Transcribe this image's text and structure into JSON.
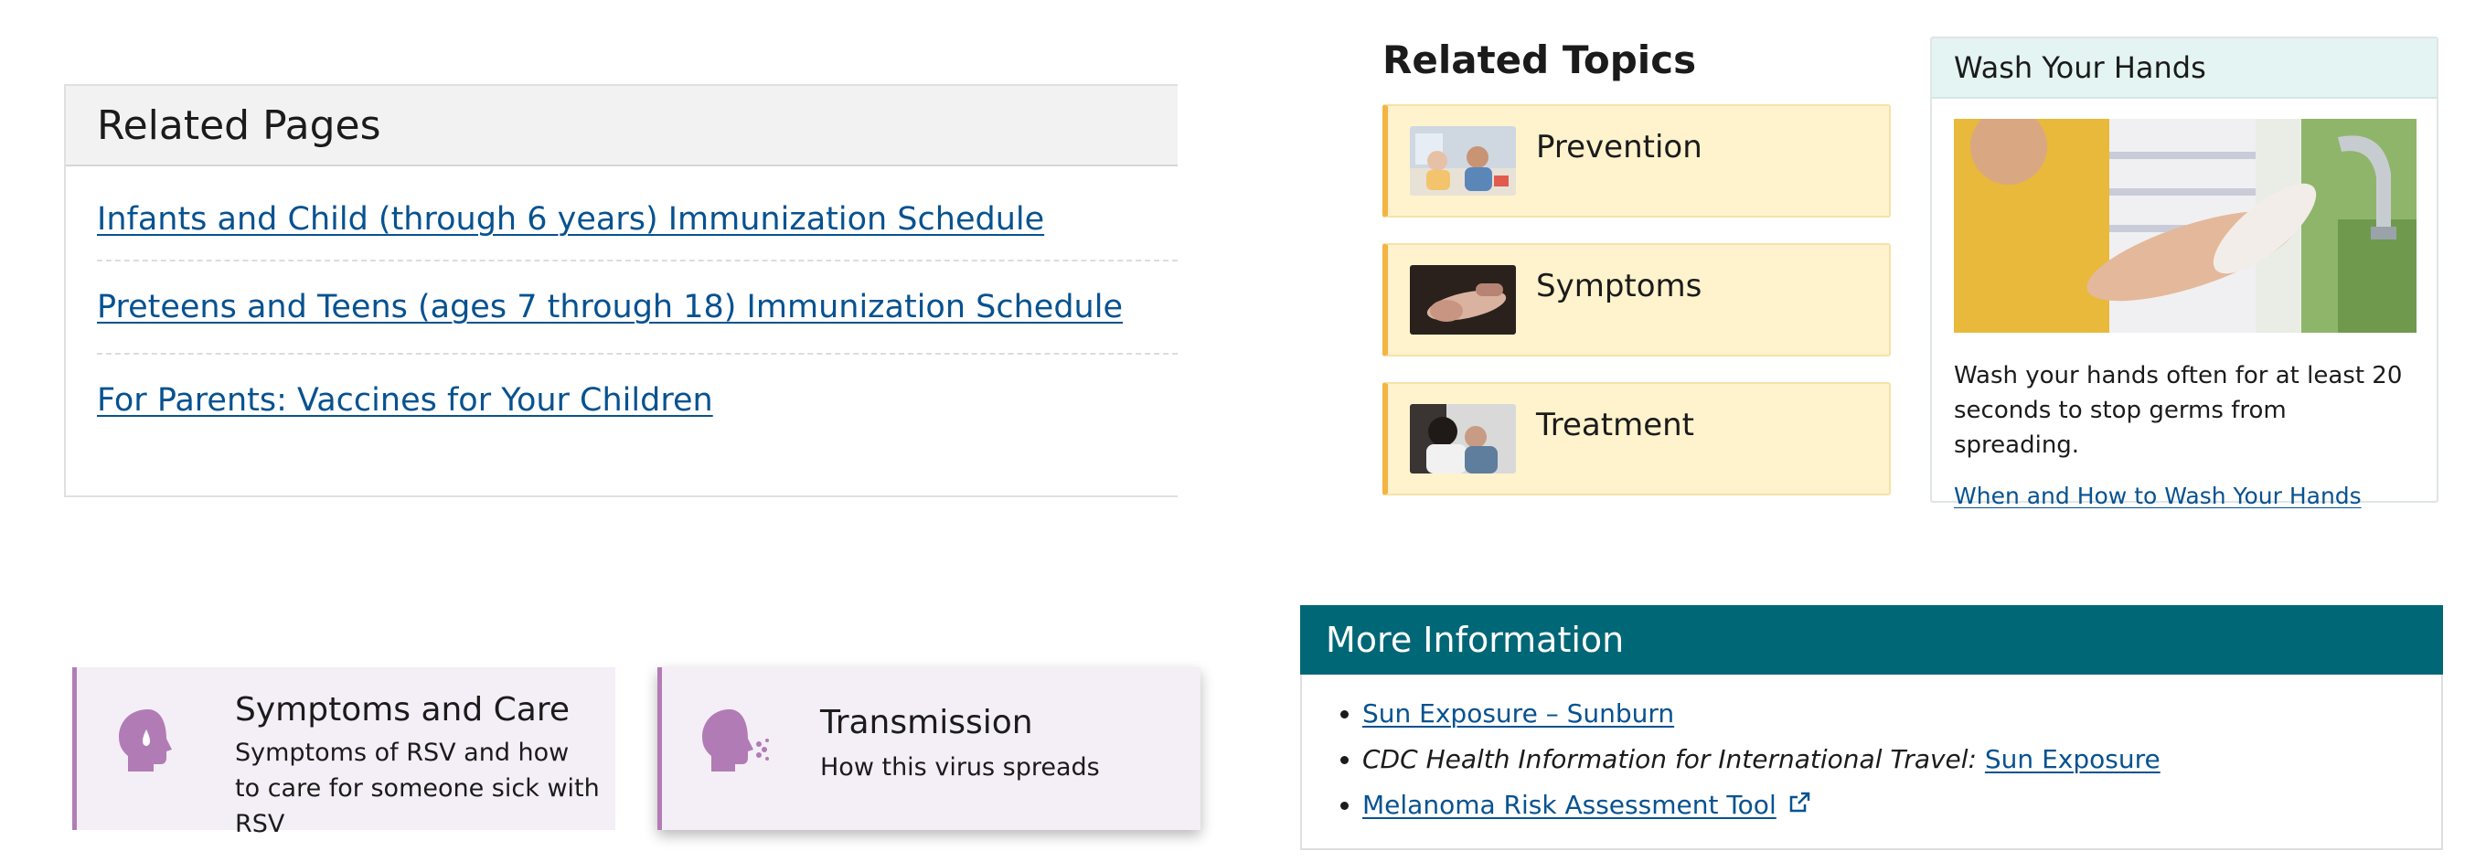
{
  "related_pages": {
    "title": "Related Pages",
    "links": [
      "Infants and Child (through 6 years) Immunization Schedule",
      "Preteens and Teens (ages 7 through 18) Immunization Schedule",
      "For Parents: Vaccines for Your Children"
    ]
  },
  "related_topics": {
    "title": "Related Topics",
    "items": [
      {
        "label": "Prevention"
      },
      {
        "label": "Symptoms"
      },
      {
        "label": "Treatment"
      }
    ]
  },
  "wash_card": {
    "title": "Wash Your Hands",
    "text": "Wash your hands often for at least 20 seconds to stop germs from spreading.",
    "link": "When and How to Wash Your Hands"
  },
  "callouts": [
    {
      "title": "Symptoms and Care",
      "description": "Symptoms of RSV and how to care for someone sick with RSV",
      "icon": "head-tear-icon"
    },
    {
      "title": "Transmission",
      "description": "How this virus spreads",
      "icon": "head-cough-icon"
    }
  ],
  "more_info": {
    "title": "More Information",
    "item1_link": "Sun Exposure – Sunburn",
    "item2_prefix": "CDC Health Information for International Travel:",
    "item2_link": "Sun Exposure",
    "item3_link": "Melanoma Risk Assessment Tool"
  },
  "colors": {
    "link": "#075290",
    "topic_card_bg": "#fff3cd",
    "topic_card_accent": "#f5b342",
    "callout_bg": "#f4eef6",
    "callout_accent": "#b17cb5",
    "more_info_header": "#006777",
    "wash_header_bg": "#e3f4f2"
  }
}
